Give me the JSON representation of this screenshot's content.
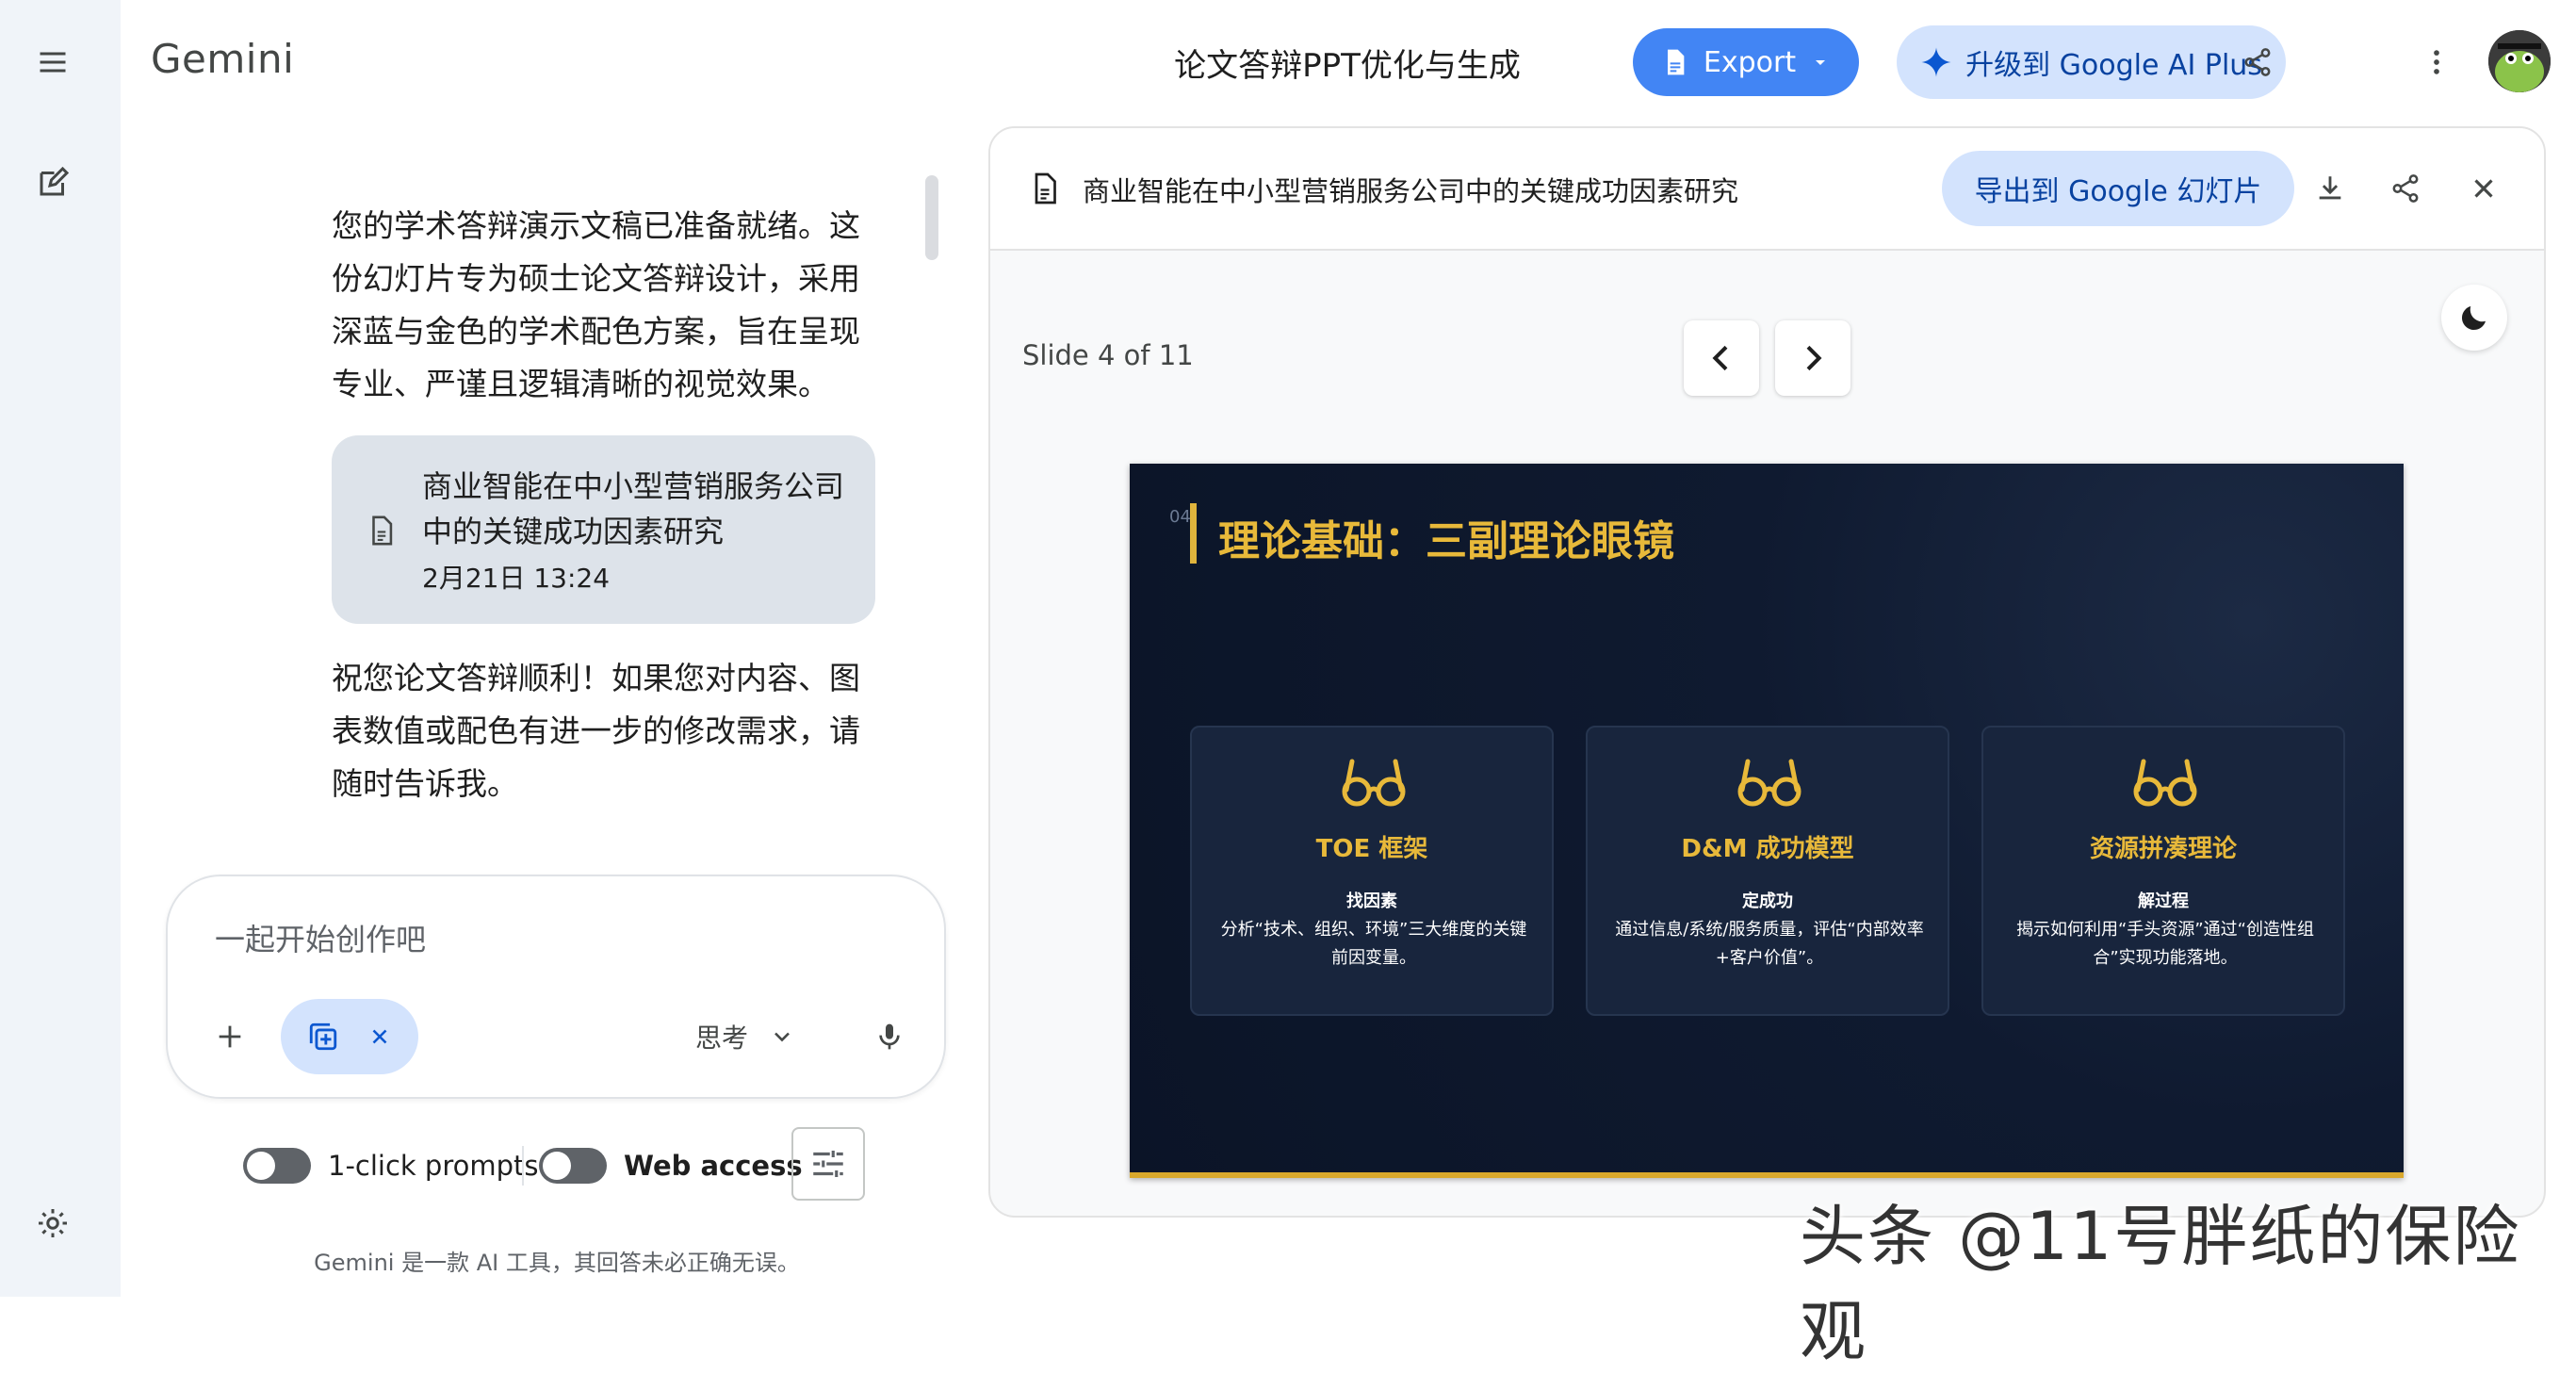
{
  "app": {
    "brand": "Gemini"
  },
  "header": {
    "title": "论文答辩PPT优化与生成",
    "export_label": "Export",
    "upgrade_label": "升级到 Google AI Plus",
    "icons": [
      "menu-icon",
      "new-chat-icon",
      "share-icon",
      "more-vert-icon",
      "settings-icon"
    ]
  },
  "chat": {
    "response_intro": "您的学术答辩演示文稿已准备就绪。这份幻灯片专为硕士论文答辩设计，采用深蓝与金色的学术配色方案，旨在呈现专业、严谨且逻辑清晰的视觉效果。",
    "file_card": {
      "title": "商业智能在中小型营销服务公司中的关键成功因素研究",
      "timestamp": "2月21日 13:24"
    },
    "response_outro": "祝您论文答辩顺利！如果您对内容、图表数值或配色有进一步的修改需求，请随时告诉我。"
  },
  "input": {
    "placeholder": "一起开始创作吧",
    "mode_label": "思考"
  },
  "toggles": {
    "one_click_label": "1-click prompts",
    "web_access_label": "Web access"
  },
  "disclaimer": "Gemini 是一款 AI 工具，其回答未必正确无误。",
  "panel": {
    "doc_title": "商业智能在中小型营销服务公司中的关键成功因素研究",
    "export_slides_label": "导出到 Google 幻灯片",
    "slide_counter": "Slide 4 of 11"
  },
  "slide": {
    "number": "04",
    "heading": "理论基础：三副理论眼镜",
    "colors": {
      "background": "#0b1427",
      "accent": "#e8b93a",
      "card": "#18253d"
    },
    "cards": [
      {
        "title": "TOE 框架",
        "subtitle": "找因素",
        "description": "分析“技术、组织、环境”三大维度的关键前因变量。"
      },
      {
        "title": "D&M 成功模型",
        "subtitle": "定成功",
        "description": "通过信息/系统/服务质量，评估“内部效率+客户价值”。"
      },
      {
        "title": "资源拼凑理论",
        "subtitle": "解过程",
        "description": "揭示如何利用“手头资源”通过“创造性组合”实现功能落地。"
      }
    ]
  },
  "watermark": "头条 @11号胖纸的保险观",
  "theme": {
    "primary": "#4285f4",
    "chip": "#d3e3fd",
    "rail": "#f0f4f9"
  }
}
